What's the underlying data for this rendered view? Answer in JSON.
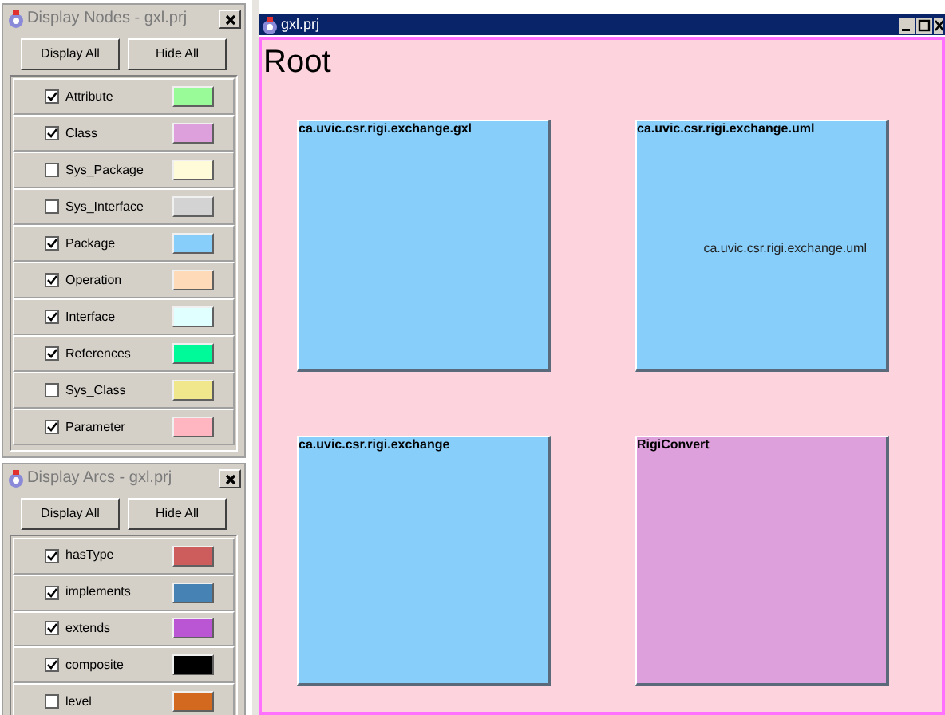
{
  "node_panel": {
    "title": "Display Nodes - gxl.prj",
    "buttons": [
      "Display All",
      "Hide All"
    ],
    "items": [
      {
        "label": "Attribute",
        "checked": true,
        "color": "#98fb98"
      },
      {
        "label": "Class",
        "checked": true,
        "color": "#dda0dd"
      },
      {
        "label": "Sys_Package",
        "checked": false,
        "color": "#fffad8"
      },
      {
        "label": "Sys_Interface",
        "checked": false,
        "color": "#d3d3d3"
      },
      {
        "label": "Package",
        "checked": true,
        "color": "#87cefa"
      },
      {
        "label": "Operation",
        "checked": true,
        "color": "#ffdab9"
      },
      {
        "label": "Interface",
        "checked": true,
        "color": "#e0ffff"
      },
      {
        "label": "References",
        "checked": true,
        "color": "#00fa9a"
      },
      {
        "label": "Sys_Class",
        "checked": false,
        "color": "#f0e68c"
      },
      {
        "label": "Parameter",
        "checked": true,
        "color": "#ffb6c1"
      }
    ]
  },
  "arc_panel": {
    "title": "Display Arcs - gxl.prj",
    "buttons": [
      "Display All",
      "Hide All"
    ],
    "items": [
      {
        "label": "hasType",
        "checked": true,
        "color": "#cd5c5c"
      },
      {
        "label": "implements",
        "checked": true,
        "color": "#4682b4"
      },
      {
        "label": "extends",
        "checked": true,
        "color": "#ba55d3"
      },
      {
        "label": "composite",
        "checked": true,
        "color": "#000000"
      },
      {
        "label": "level",
        "checked": false,
        "color": "#d2691e"
      }
    ]
  },
  "main_window": {
    "title": "gxl.prj",
    "heading": "Root",
    "nodes": [
      {
        "label": "ca.uvic.csr.rigi.exchange.gxl",
        "color": "#87cefa"
      },
      {
        "label": "ca.uvic.csr.rigi.exchange.uml",
        "color": "#87cefa",
        "inner_label": "ca.uvic.csr.rigi.exchange.uml"
      },
      {
        "label": "ca.uvic.csr.rigi.exchange",
        "color": "#87cefa"
      },
      {
        "label": "RigiConvert",
        "color": "#dda0dd"
      }
    ]
  }
}
